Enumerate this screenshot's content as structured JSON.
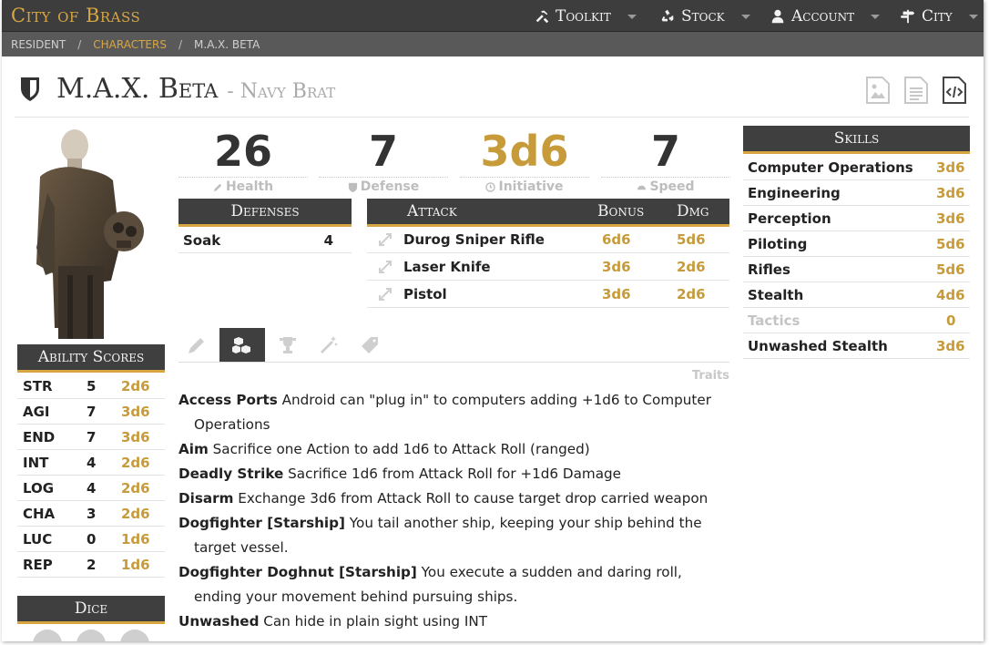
{
  "nav": {
    "brand": "City of Brass",
    "items": [
      {
        "label": "Toolkit",
        "icon": "wrench-hammer-icon"
      },
      {
        "label": "Stock",
        "icon": "recycle-icon"
      },
      {
        "label": "Account",
        "icon": "user-icon"
      },
      {
        "label": "City",
        "icon": "signpost-icon"
      }
    ]
  },
  "breadcrumb": [
    "Resident",
    "Characters",
    "M.A.X. Beta"
  ],
  "character": {
    "name": "M.A.X. Beta",
    "subtitle": "- Navy Brat"
  },
  "stats": [
    {
      "value": "26",
      "label": "Health",
      "icon": "pencil-icon"
    },
    {
      "value": "7",
      "label": "Defense",
      "icon": "shield-icon"
    },
    {
      "value": "3d6",
      "label": "Initiative",
      "icon": "clock-icon"
    },
    {
      "value": "7",
      "label": "Speed",
      "icon": "dashboard-icon"
    }
  ],
  "defenses": {
    "header": "Defenses",
    "rows": [
      {
        "name": "Soak",
        "value": "4"
      }
    ]
  },
  "attack": {
    "header": "Attack",
    "bonus_header": "Bonus",
    "dmg_header": "Dmg",
    "rows": [
      {
        "name": "Durog Sniper Rifle",
        "bonus": "6d6",
        "dmg": "5d6"
      },
      {
        "name": "Laser Knife",
        "bonus": "3d6",
        "dmg": "2d6"
      },
      {
        "name": "Pistol",
        "bonus": "3d6",
        "dmg": "2d6"
      }
    ]
  },
  "abilities": {
    "header": "Ability Scores",
    "rows": [
      {
        "k": "STR",
        "v": "5",
        "d": "2d6"
      },
      {
        "k": "AGI",
        "v": "7",
        "d": "3d6"
      },
      {
        "k": "END",
        "v": "7",
        "d": "3d6"
      },
      {
        "k": "INT",
        "v": "4",
        "d": "2d6"
      },
      {
        "k": "LOG",
        "v": "4",
        "d": "2d6"
      },
      {
        "k": "CHA",
        "v": "3",
        "d": "2d6"
      },
      {
        "k": "LUC",
        "v": "0",
        "d": "1d6"
      },
      {
        "k": "REP",
        "v": "2",
        "d": "1d6"
      }
    ]
  },
  "dice": {
    "header": "Dice"
  },
  "traits_label": "Traits",
  "traits": [
    {
      "name": "Access Ports",
      "text": "Android can \"plug in\" to computers adding +1d6 to Computer Operations"
    },
    {
      "name": "Aim",
      "text": "Sacrifice one Action to add 1d6 to Attack Roll (ranged)"
    },
    {
      "name": "Deadly Strike",
      "text": "Sacrifice 1d6 from Attack Roll for +1d6 Damage"
    },
    {
      "name": "Disarm",
      "text": "Exchange 3d6 from Attack Roll to cause target drop carried weapon"
    },
    {
      "name": "Dogfighter [Starship]",
      "text": "You tail another ship, keeping your ship behind the target vessel."
    },
    {
      "name": "Dogfighter Doghnut [Starship]",
      "text": "You execute a sudden and daring roll, ending your movement behind pursuing ships."
    },
    {
      "name": "Unwashed",
      "text": "Can hide in plain sight using INT"
    }
  ],
  "skills": {
    "header": "Skills",
    "rows": [
      {
        "name": "Computer Operations",
        "d": "3d6"
      },
      {
        "name": "Engineering",
        "d": "3d6"
      },
      {
        "name": "Perception",
        "d": "3d6"
      },
      {
        "name": "Piloting",
        "d": "5d6"
      },
      {
        "name": "Rifles",
        "d": "5d6"
      },
      {
        "name": "Stealth",
        "d": "4d6"
      },
      {
        "name": "Tactics",
        "d": "0"
      },
      {
        "name": "Unwashed Stealth",
        "d": "3d6"
      }
    ]
  },
  "colors": {
    "accent": "#d8a640",
    "dark": "#3f3f3f",
    "gold_text": "#c79a3a",
    "muted": "#c4c4c4"
  }
}
